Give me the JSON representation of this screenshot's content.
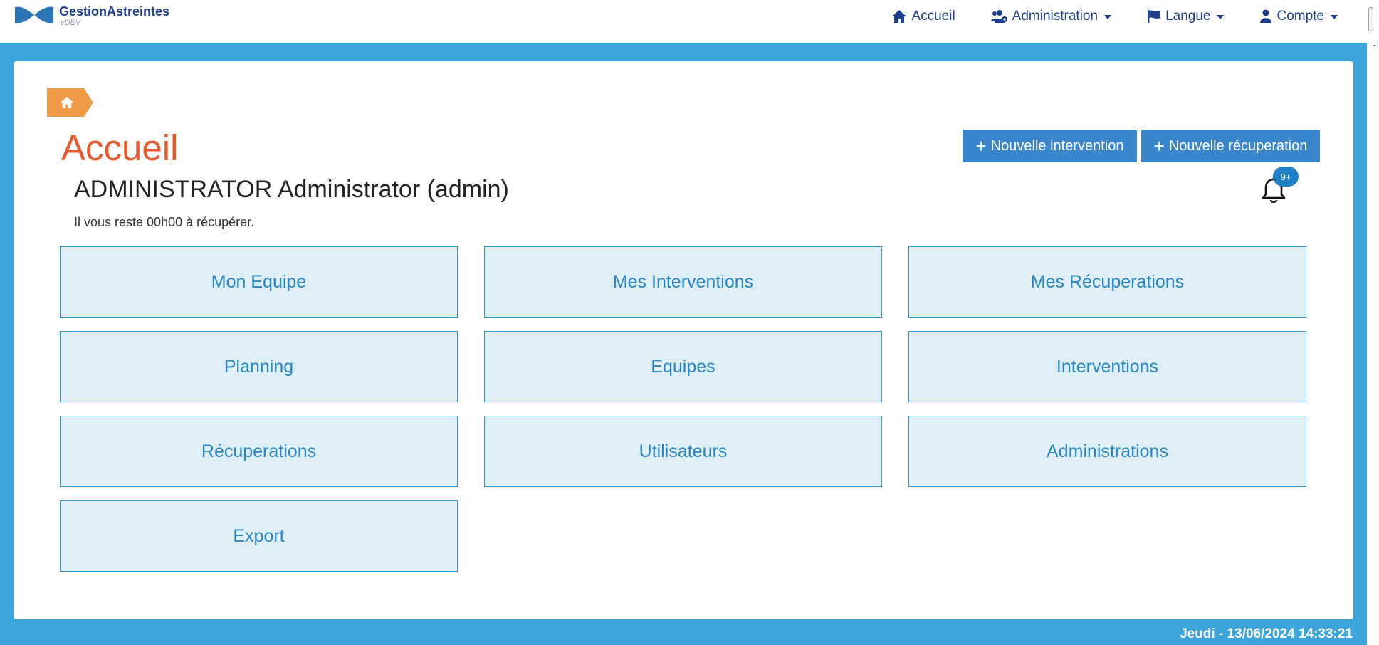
{
  "app": {
    "name": "GestionAstreintes",
    "version": "vDEV"
  },
  "nav": {
    "items": [
      {
        "label": "Accueil",
        "icon": "home-icon",
        "dropdown": false
      },
      {
        "label": "Administration",
        "icon": "users-cog-icon",
        "dropdown": true
      },
      {
        "label": "Langue",
        "icon": "flag-icon",
        "dropdown": true
      },
      {
        "label": "Compte",
        "icon": "user-icon",
        "dropdown": true
      }
    ]
  },
  "breadcrumb": {
    "icon": "home-icon"
  },
  "page": {
    "title": "Accueil",
    "user_name": "ADMINISTRATOR Administrator (admin)",
    "remaining": "Il vous reste 00h00 à récupérer."
  },
  "actions": {
    "new_intervention": "Nouvelle intervention",
    "new_recuperation": "Nouvelle récuperation"
  },
  "notifications": {
    "icon": "bell-icon",
    "badge": "9+"
  },
  "tiles": [
    "Mon Equipe",
    "Mes Interventions",
    "Mes Récuperations",
    "Planning",
    "Equipes",
    "Interventions",
    "Récuperations",
    "Utilisateurs",
    "Administrations",
    "Export"
  ],
  "footer": {
    "datetime": "Jeudi - 13/06/2024 14:33:21"
  },
  "colors": {
    "background": "#3ba5da",
    "brand": "#1e3f8c",
    "title": "#e85a2e",
    "breadcrumb": "#ef9a45",
    "button": "#3a86cd",
    "tile_bg": "#dfeff8",
    "tile_border": "#2f95cf",
    "tile_text": "#2a86c2"
  }
}
